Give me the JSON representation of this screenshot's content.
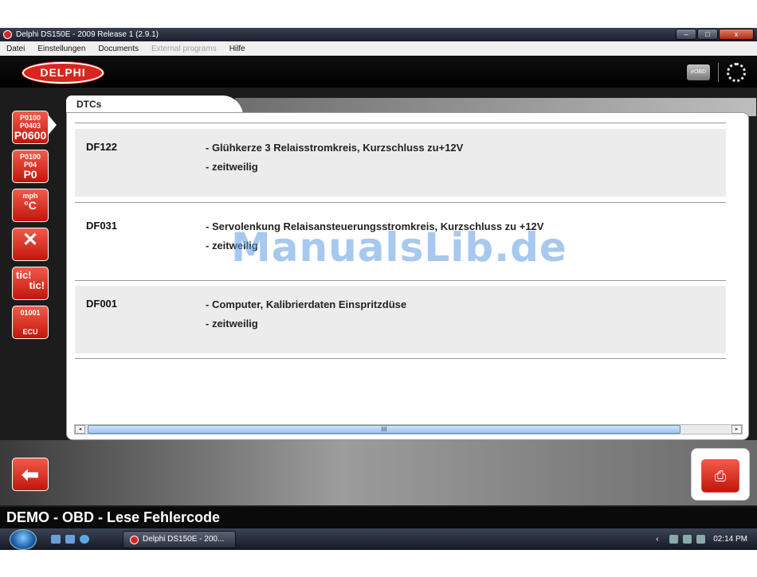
{
  "window": {
    "title": "Delphi DS150E - 2009 Release 1 (2.9.1)",
    "minimize": "–",
    "maximize": "□",
    "close": "x"
  },
  "menu": [
    "Datei",
    "Einstellungen",
    "Documents",
    "External programs",
    "Hilfe"
  ],
  "header": {
    "logo": "DELPHI",
    "badge": "eOBD"
  },
  "sidebar": [
    {
      "name": "sidebar-read-dtc",
      "line1": "P0100\nP0403",
      "line2": "P0600"
    },
    {
      "name": "sidebar-clear-dtc",
      "line1": "P0100\nP04",
      "line2": "P0"
    },
    {
      "name": "sidebar-live-data",
      "line1": "mph",
      "line2": "°C"
    },
    {
      "name": "sidebar-tools",
      "line1": "",
      "line2": "✕"
    },
    {
      "name": "sidebar-tic-tic",
      "line1": "tic!",
      "line2": "tic!"
    },
    {
      "name": "sidebar-ecu",
      "line1": "01001",
      "line2": "ECU"
    }
  ],
  "tab": {
    "label": "DTCs"
  },
  "dtcs": [
    {
      "code": "DF122",
      "desc": "- Glühkerze 3 Relaisstromkreis, Kurzschluss zu+12V",
      "status": "- zeitweilig"
    },
    {
      "code": "DF031",
      "desc": "- Servolenkung Relaisansteuerungsstromkreis, Kurzschluss zu +12V",
      "status": "- zeitweilig"
    },
    {
      "code": "DF001",
      "desc": "- Computer, Kalibrierdaten Einspritzdüse",
      "status": "- zeitweilig"
    }
  ],
  "watermark": "ManualsLib.de",
  "scrollbar": {
    "left": "◂",
    "right": "▸",
    "grip": "III"
  },
  "status": "DEMO - OBD - Lese Fehlercode",
  "taskbar": {
    "task": "Delphi DS150E - 200...",
    "clock": "02:14 PM"
  }
}
